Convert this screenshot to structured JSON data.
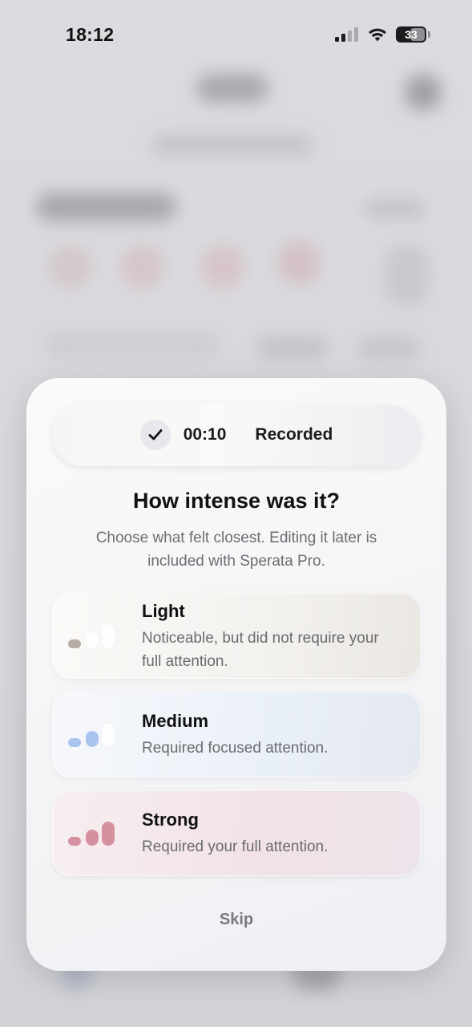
{
  "status_bar": {
    "time": "18:12",
    "battery_level": "33"
  },
  "modal": {
    "recorded_pill": {
      "duration": "00:10",
      "status": "Recorded"
    },
    "title": "How intense was it?",
    "subtitle": "Choose what felt closest. Editing it later is included with Sperata Pro.",
    "options": [
      {
        "label": "Light",
        "description": "Noticeable, but did not require your full attention.",
        "active_bars": 1,
        "total_bars": 3,
        "color": "#b8aea6"
      },
      {
        "label": "Medium",
        "description": "Required focused attention.",
        "active_bars": 2,
        "total_bars": 3,
        "color": "#a9c4ee"
      },
      {
        "label": "Strong",
        "description": "Required your full attention.",
        "active_bars": 3,
        "total_bars": 3,
        "color": "#d6909f"
      }
    ],
    "skip_label": "Skip"
  }
}
